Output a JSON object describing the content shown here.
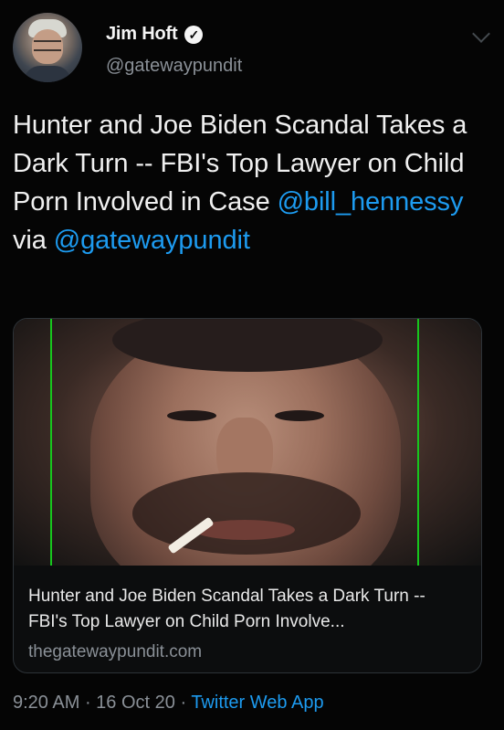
{
  "tweet": {
    "author": {
      "display_name": "Jim Hoft",
      "handle": "@gatewaypundit",
      "verified_icon": "check-icon",
      "avatar_icon": "avatar"
    },
    "text_parts": [
      "Hunter and Joe Biden Scandal Takes a Dark Turn -- FBI's Top Lawyer on Child Porn Involved in Case ",
      "@bill_hennessy",
      "  via ",
      "@gatewaypundit"
    ],
    "card": {
      "title": "Hunter and Joe Biden Scandal Takes a Dark Turn -- FBI's Top Lawyer on Child Porn Involve...",
      "domain": "thegatewaypundit.com"
    },
    "meta": {
      "time": "9:20 AM",
      "separator_1": " · ",
      "date": "16 Oct 20",
      "separator_2": " · ",
      "app": "Twitter Web App"
    }
  },
  "colors": {
    "background": "#050505",
    "text": "#e7e9ea",
    "secondary": "#8a9097",
    "link": "#1d9bf0",
    "card_border": "#2d3338",
    "image_frame_line": "#17c61d"
  }
}
